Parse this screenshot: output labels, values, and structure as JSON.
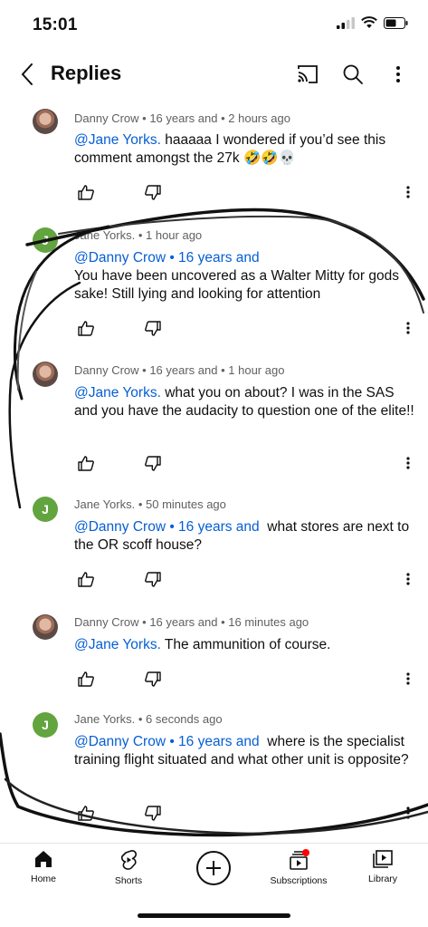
{
  "status": {
    "time": "15:01"
  },
  "header": {
    "title": "Replies",
    "back_icon": "chevron-left-icon",
    "cast_icon": "cast-icon",
    "search_icon": "search-icon",
    "more_icon": "more-vertical-icon"
  },
  "comments": [
    {
      "author": "Danny Crow",
      "tenure": "16 years and",
      "time": "2 hours ago",
      "avatar": "photo",
      "mention": "@Jane Yorks.",
      "text": "haaaaa I wondered if you’d see this comment amongst the 27k 🤣🤣💀"
    },
    {
      "author": "Jane Yorks.",
      "time": "1 hour ago",
      "avatar": "J",
      "mention": "@Danny Crow • 16 years and",
      "text": "You have been uncovered as a Walter Mitty for gods sake!  Still lying and looking for attention"
    },
    {
      "author": "Danny Crow",
      "tenure": "16 years and",
      "time": "1 hour ago",
      "avatar": "photo",
      "mention": "@Jane Yorks.",
      "text": "what you on about? I was in the SAS and you have the audacity to question one of the elite!!"
    },
    {
      "author": "Jane Yorks.",
      "time": "50 minutes ago",
      "avatar": "J",
      "mention": "@Danny Crow • 16 years and",
      "text": "what stores are next to the OR scoff house?"
    },
    {
      "author": "Danny Crow",
      "tenure": "16 years and",
      "time": "16 minutes ago",
      "avatar": "photo",
      "mention": "@Jane Yorks.",
      "text": "The ammunition of course."
    },
    {
      "author": "Jane Yorks.",
      "time": "6 seconds ago",
      "avatar": "J",
      "mention": "@Danny Crow • 16 years and",
      "text": "where is the specialist training flight situated and what other unit is opposite?"
    }
  ],
  "nav": {
    "home": "Home",
    "shorts": "Shorts",
    "subscriptions": "Subscriptions",
    "library": "Library"
  },
  "colors": {
    "mention": "#065fd4",
    "avatar_green": "#62a43f",
    "notification_dot": "#ff0000"
  }
}
